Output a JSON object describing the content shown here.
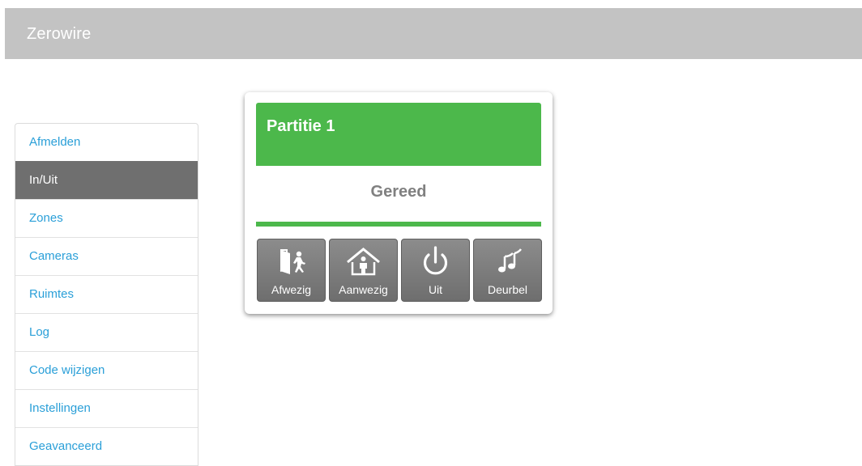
{
  "app": {
    "title": "Zerowire"
  },
  "sidebar": {
    "items": [
      {
        "label": "Afmelden",
        "active": false
      },
      {
        "label": "In/Uit",
        "active": true
      },
      {
        "label": "Zones",
        "active": false
      },
      {
        "label": "Cameras",
        "active": false
      },
      {
        "label": "Ruimtes",
        "active": false
      },
      {
        "label": "Log",
        "active": false
      },
      {
        "label": "Code wijzigen",
        "active": false
      },
      {
        "label": "Instellingen",
        "active": false
      },
      {
        "label": "Geavanceerd",
        "active": false
      }
    ]
  },
  "partition": {
    "title": "Partitie 1",
    "status": "Gereed",
    "buttons": [
      {
        "label": "Afwezig",
        "icon": "away-exit-icon"
      },
      {
        "label": "Aanwezig",
        "icon": "home-stay-icon"
      },
      {
        "label": "Uit",
        "icon": "power-icon"
      },
      {
        "label": "Deurbel",
        "icon": "doorbell-music-icon"
      }
    ]
  },
  "colors": {
    "header": "#c3c3c3",
    "accent_green": "#4cb84b",
    "link_blue": "#2a9fd8",
    "nav_active": "#6f6f6f",
    "button_gray": "#7a7a7a"
  }
}
